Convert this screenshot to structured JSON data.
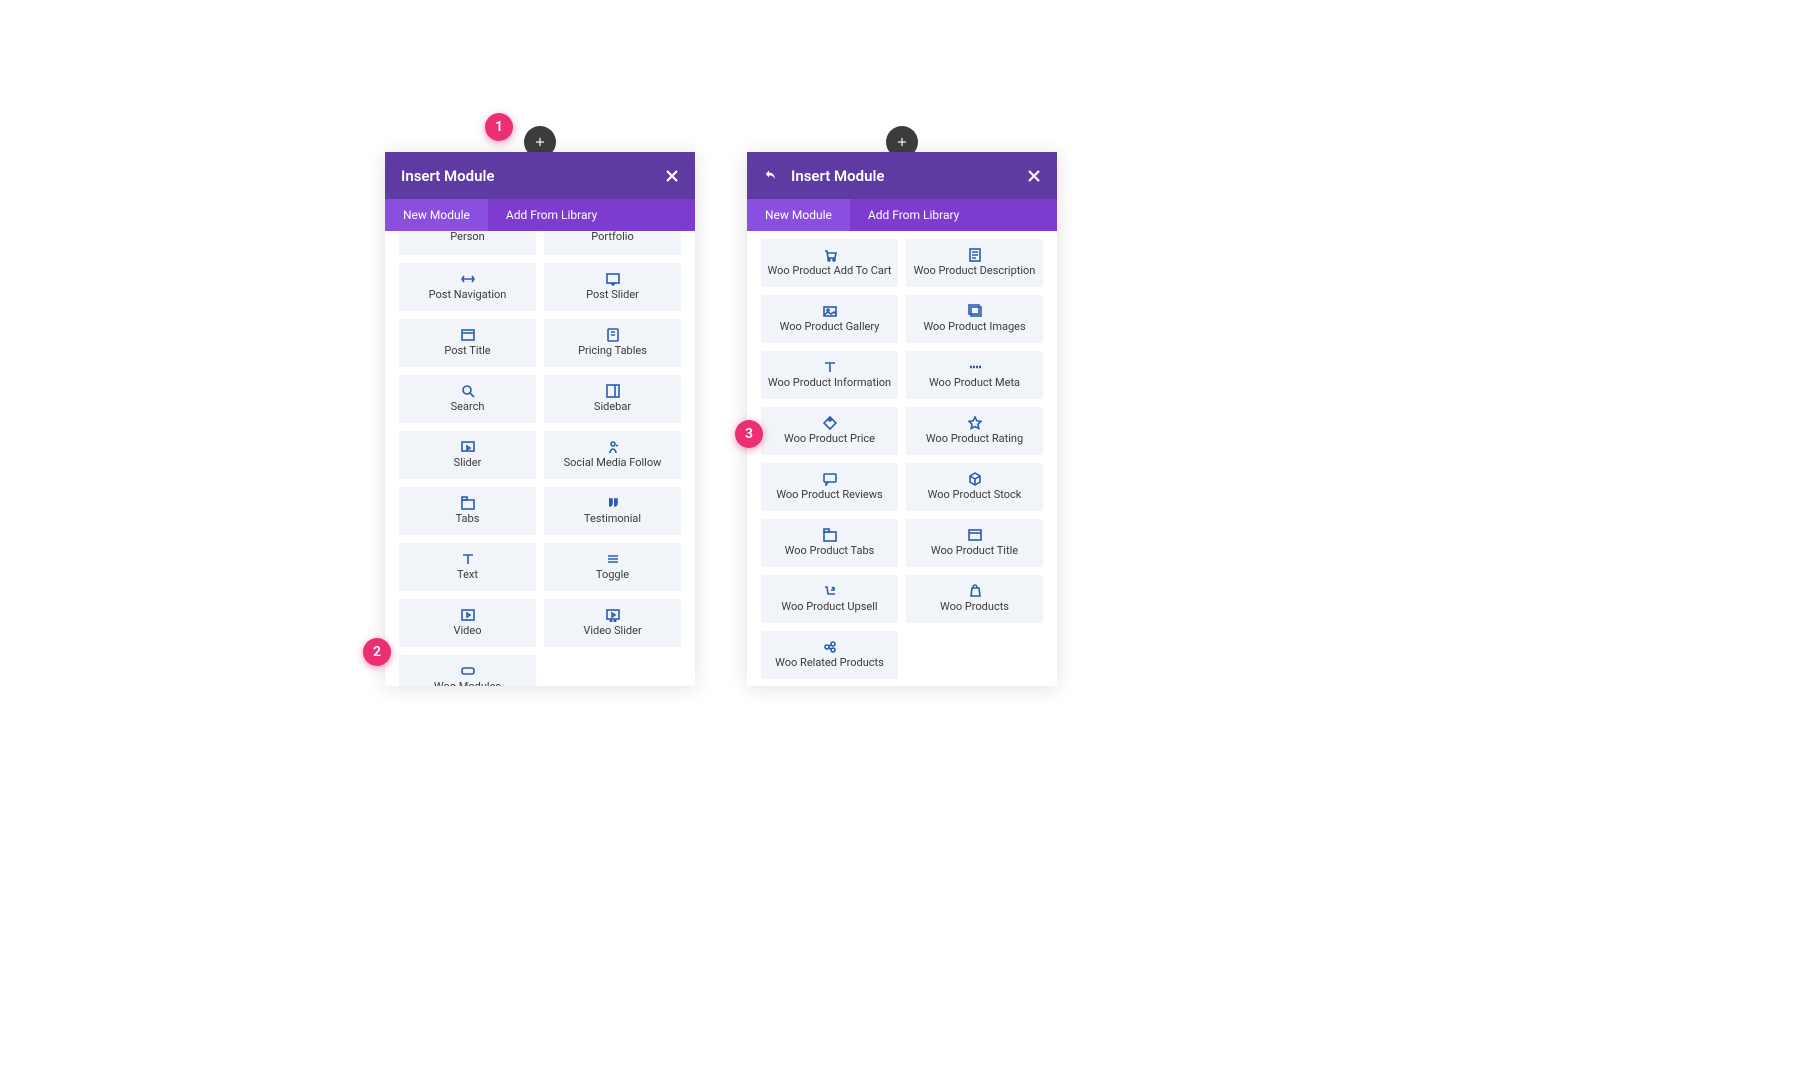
{
  "colors": {
    "headerPurple": "#5e3aa3",
    "tabPurple": "#7e3bd0",
    "tabActive": "#8b4fe0",
    "badgePink": "#ec2e74",
    "moduleBg": "#f1f5f9",
    "iconBlue": "#2b5cb0"
  },
  "callouts": {
    "b1": "1",
    "b2": "2",
    "b3": "3"
  },
  "panel1": {
    "title": "Insert Module",
    "tabs": {
      "new": "New Module",
      "library": "Add From Library"
    },
    "modules": [
      {
        "label": "Person",
        "icon": "user"
      },
      {
        "label": "Portfolio",
        "icon": "grid"
      },
      {
        "label": "Post Navigation",
        "icon": "arrows-h"
      },
      {
        "label": "Post Slider",
        "icon": "slideshow"
      },
      {
        "label": "Post Title",
        "icon": "title"
      },
      {
        "label": "Pricing Tables",
        "icon": "pricing"
      },
      {
        "label": "Search",
        "icon": "search"
      },
      {
        "label": "Sidebar",
        "icon": "sidebar"
      },
      {
        "label": "Slider",
        "icon": "slider"
      },
      {
        "label": "Social Media Follow",
        "icon": "social"
      },
      {
        "label": "Tabs",
        "icon": "tabs"
      },
      {
        "label": "Testimonial",
        "icon": "quote"
      },
      {
        "label": "Text",
        "icon": "text"
      },
      {
        "label": "Toggle",
        "icon": "toggle"
      },
      {
        "label": "Video",
        "icon": "video"
      },
      {
        "label": "Video Slider",
        "icon": "videoslider"
      },
      {
        "label": "Woo Modules",
        "icon": "woo"
      }
    ]
  },
  "panel2": {
    "title": "Insert Module",
    "tabs": {
      "new": "New Module",
      "library": "Add From Library"
    },
    "modules": [
      {
        "label": "Woo Product Add To Cart",
        "icon": "cart"
      },
      {
        "label": "Woo Product Description",
        "icon": "desc"
      },
      {
        "label": "Woo Product Gallery",
        "icon": "gallery"
      },
      {
        "label": "Woo Product Images",
        "icon": "images"
      },
      {
        "label": "Woo Product Information",
        "icon": "text"
      },
      {
        "label": "Woo Product Meta",
        "icon": "meta"
      },
      {
        "label": "Woo Product Price",
        "icon": "price"
      },
      {
        "label": "Woo Product Rating",
        "icon": "star"
      },
      {
        "label": "Woo Product Reviews",
        "icon": "reviews"
      },
      {
        "label": "Woo Product Stock",
        "icon": "stock"
      },
      {
        "label": "Woo Product Tabs",
        "icon": "tabs"
      },
      {
        "label": "Woo Product Title",
        "icon": "title"
      },
      {
        "label": "Woo Product Upsell",
        "icon": "upsell"
      },
      {
        "label": "Woo Products",
        "icon": "products"
      },
      {
        "label": "Woo Related Products",
        "icon": "related"
      }
    ]
  }
}
